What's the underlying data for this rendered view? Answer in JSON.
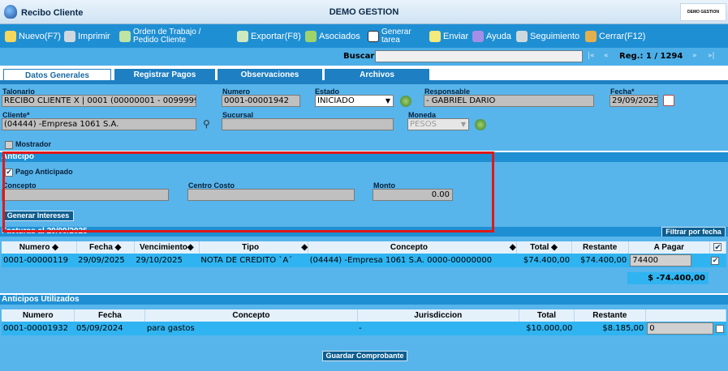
{
  "window": {
    "title": "Recibo Cliente",
    "center_title": "DEMO GESTION",
    "logo_text": "DEMO GESTION"
  },
  "toolbar": [
    {
      "label": "Nuevo(F7)",
      "icon": "new-icon",
      "color": "#f4d75c"
    },
    {
      "label": "Imprimir",
      "icon": "printer-icon",
      "color": "#cfd8dc"
    },
    {
      "label": "Orden de Trabajo /",
      "label2": "Pedido Cliente",
      "icon": "work-order-icon",
      "color": "#bfe3a0"
    },
    {
      "label": "Exportar(F8)",
      "icon": "export-icon",
      "color": "#cde9bf"
    },
    {
      "label": "Asociados",
      "icon": "associates-icon",
      "color": "#9ed36b"
    },
    {
      "label": "Generar",
      "label2": "tarea",
      "icon": "task-icon",
      "color": "#ffffff"
    },
    {
      "label": "Enviar",
      "icon": "send-icon",
      "color": "#f2ea7a"
    },
    {
      "label": "Ayuda",
      "icon": "help-icon",
      "color": "#a58ee6"
    },
    {
      "label": "Seguimiento",
      "icon": "tracking-icon",
      "color": "#cfd8dc"
    },
    {
      "label": "Cerrar(F12)",
      "icon": "close-icon",
      "color": "#e3b04c"
    }
  ],
  "search": {
    "label": "Buscar",
    "value": "",
    "first": "|«",
    "prev": "«",
    "reg_label": "Reg.: 1 / 1294",
    "next": "»",
    "last": "»|"
  },
  "tabs": [
    "Datos Generales",
    "Registrar Pagos",
    "Observaciones",
    "Archivos"
  ],
  "form": {
    "talonario_label": "Talonario",
    "talonario": "RECIBO CLIENTE X | 0001 (00000001 - 00999999",
    "numero_label": "Numero",
    "numero": "0001-00001942",
    "estado_label": "Estado",
    "estado": "INICIADO",
    "responsable_label": "Responsable",
    "responsable": "- GABRIEL DARIO",
    "fecha_label": "Fecha*",
    "fecha": "29/09/2025",
    "cliente_label": "Cliente*",
    "cliente": "(04444) -Empresa 1061 S.A.",
    "sucursal_label": "Sucursal",
    "sucursal": "",
    "moneda_label": "Moneda",
    "moneda": "PESOS",
    "mostrador_label": "Mostrador"
  },
  "anticipo": {
    "title": "Anticipo",
    "pago_anticipado_label": "Pago Anticipado",
    "concepto_label": "Concepto",
    "concepto": "",
    "centro_costo_label": "Centro Costo",
    "centro_costo": "",
    "monto_label": "Monto",
    "monto": "0.00",
    "generar_intereses": "Generar Intereses"
  },
  "facturas": {
    "title": "Facturas al 29/09/2025",
    "filter_button": "Filtrar por fecha",
    "columns": [
      "Numero",
      "Fecha",
      "Vencimiento",
      "Tipo",
      "Concepto",
      "Total",
      "Restante",
      "A Pagar"
    ],
    "rows": [
      {
        "numero": "0001-00000119",
        "fecha": "29/09/2025",
        "vencimiento": "29/10/2025",
        "tipo": "NOTA DE CREDITO `A´",
        "concepto": "(04444) -Empresa 1061 S.A. 0000-00000000",
        "total": "$74.400,00",
        "restante": "$74.400,00",
        "a_pagar": "74400"
      }
    ],
    "total_a_pagar": "$ -74.400,00"
  },
  "anticipos_utilizados": {
    "title": "Anticipos Utilizados",
    "columns": [
      "Numero",
      "Fecha",
      "Concepto",
      "Jurisdiccion",
      "Total",
      "Restante"
    ],
    "rows": [
      {
        "numero": "0001-00001932",
        "fecha": "05/09/2024",
        "concepto": "para gastos",
        "jurisdiccion": "-",
        "total": "$10.000,00",
        "restante": "$8.185,00",
        "input": "0"
      }
    ]
  },
  "actions": {
    "save": "Guardar Comprobante"
  }
}
